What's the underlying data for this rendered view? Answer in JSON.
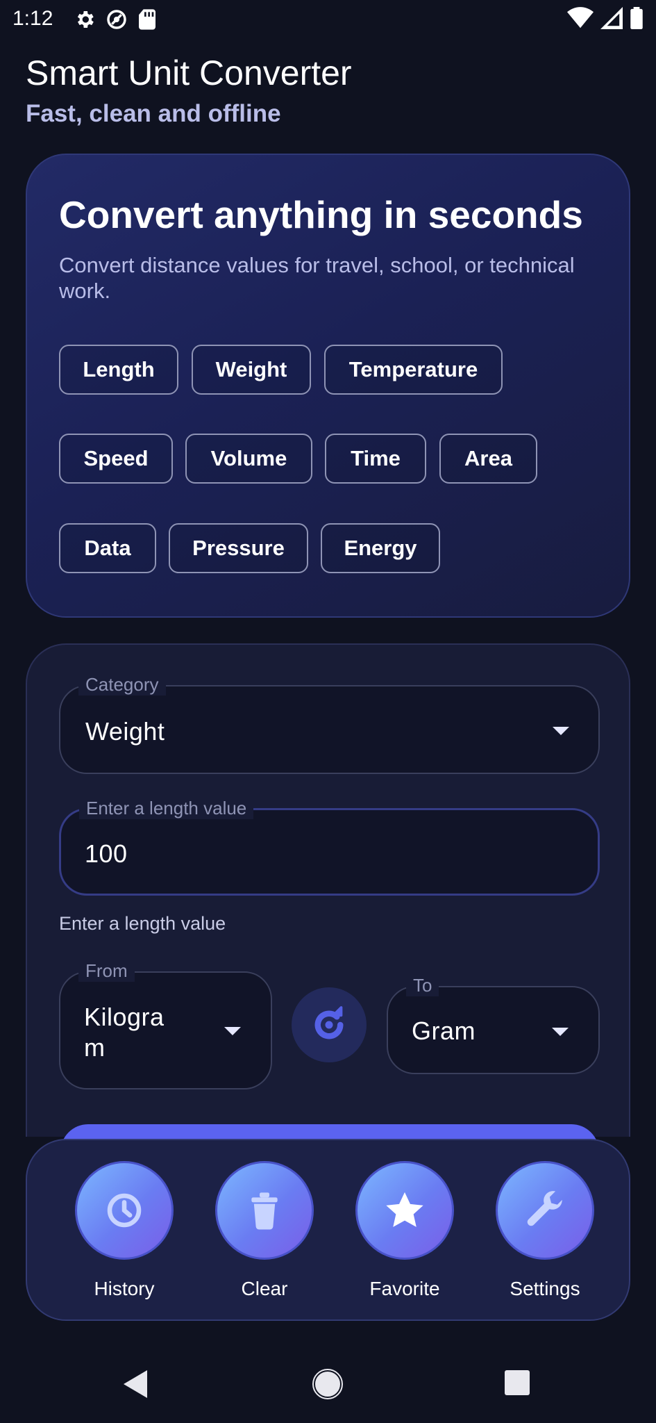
{
  "status_bar": {
    "time": "1:12"
  },
  "header": {
    "title": "Smart Unit Converter",
    "subtitle": "Fast, clean and offline"
  },
  "hero": {
    "title": "Convert anything in seconds",
    "description": "Convert distance values for travel, school, or technical work.",
    "categories": [
      "Length",
      "Weight",
      "Temperature",
      "Speed",
      "Volume",
      "Time",
      "Area",
      "Data",
      "Pressure",
      "Energy"
    ]
  },
  "form": {
    "category": {
      "label": "Category",
      "value": "Weight"
    },
    "input": {
      "label": "Enter a length value",
      "value": "100"
    },
    "helper": "Enter a length value",
    "from": {
      "label": "From",
      "value_line1": "Kilogra",
      "value_line2": "m"
    },
    "to": {
      "label": "To",
      "value": "Gram"
    }
  },
  "actions": [
    {
      "label": "History",
      "icon": "clock-icon"
    },
    {
      "label": "Clear",
      "icon": "trash-icon"
    },
    {
      "label": "Favorite",
      "icon": "star-icon"
    },
    {
      "label": "Settings",
      "icon": "wrench-icon"
    }
  ],
  "colors": {
    "background": "#0f1220",
    "accent": "#5b63f0",
    "muted_text": "#b9bde8"
  }
}
